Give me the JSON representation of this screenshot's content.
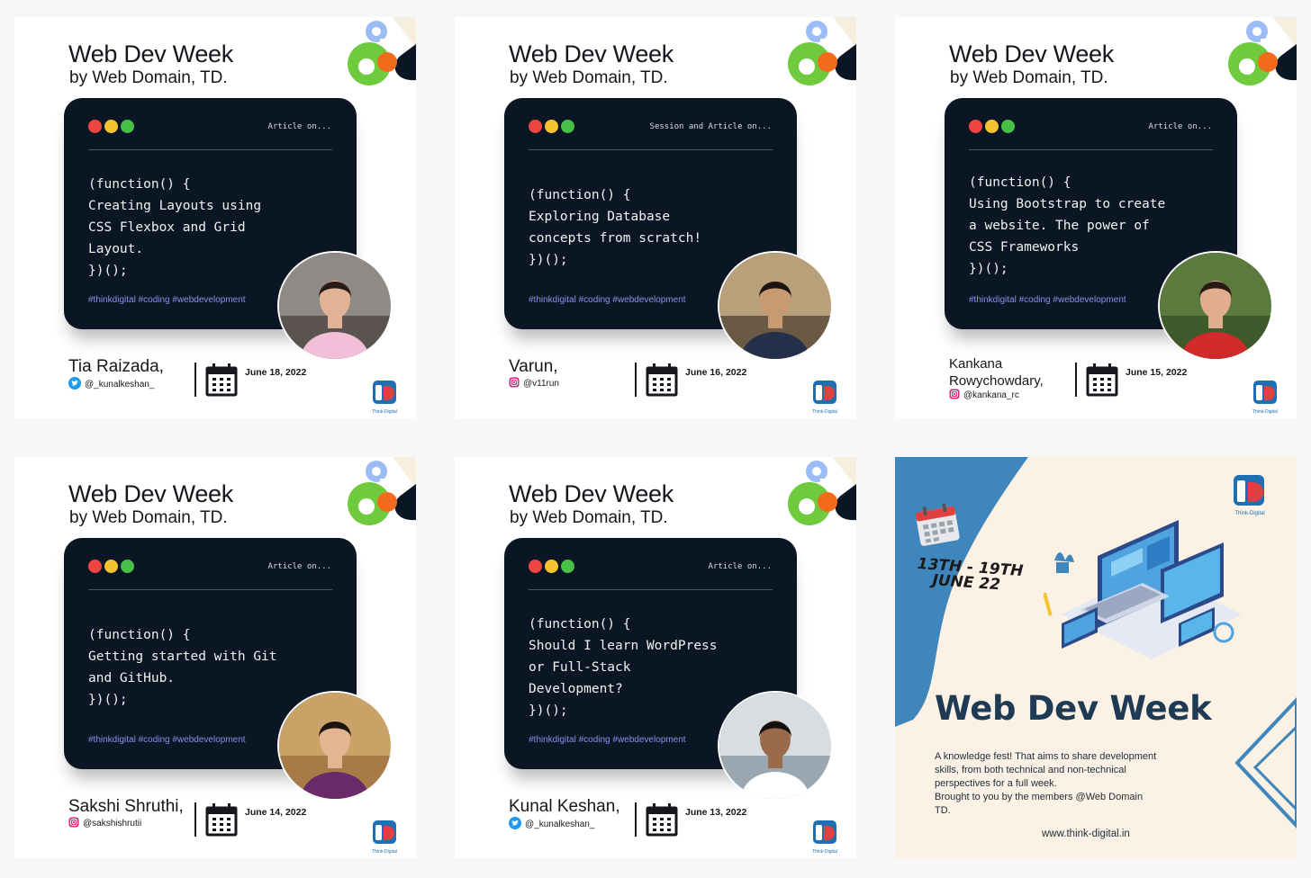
{
  "cards": [
    {
      "title": "Web Dev Week",
      "subtitle": "by Web Domain, TD.",
      "card_label": "Article on...",
      "code_lines": [
        "(function() {",
        "Creating Layouts using",
        "CSS Flexbox and Grid",
        "Layout.",
        "})();"
      ],
      "hashtags": "#thinkdigital #coding #webdevelopment",
      "author_name_lines": [
        "Tia Raizada,"
      ],
      "author_handle": "@_kunalkeshan_",
      "handle_icon": "twitter-icon",
      "date": "June 18, 2022"
    },
    {
      "title": "Web Dev Week",
      "subtitle": "by Web Domain, TD.",
      "card_label": "Session and Article on...",
      "code_lines": [
        "(function() {",
        "Exploring Database",
        "concepts from scratch!",
        "})();"
      ],
      "hashtags": "#thinkdigital #coding #webdevelopment",
      "author_name_lines": [
        "Varun,"
      ],
      "author_handle": "@v11run",
      "handle_icon": "instagram-icon",
      "date": "June 16, 2022"
    },
    {
      "title": "Web Dev Week",
      "subtitle": "by Web Domain, TD.",
      "card_label": "Article on...",
      "code_lines": [
        "(function() {",
        "Using Bootstrap to create",
        "a website. The power of",
        "CSS Frameworks",
        "})();"
      ],
      "hashtags": "#thinkdigital #coding #webdevelopment",
      "author_name_lines": [
        "Kankana",
        "Rowychowdary,"
      ],
      "author_handle": "@kankana_rc",
      "handle_icon": "instagram-icon",
      "date": "June 15, 2022"
    },
    {
      "title": "Web Dev Week",
      "subtitle": "by Web Domain, TD.",
      "card_label": "Article on...",
      "code_lines": [
        "(function() {",
        "Getting started with Git",
        "and GitHub.",
        "})();"
      ],
      "hashtags": "#thinkdigital #coding #webdevelopment",
      "author_name_lines": [
        "Sakshi Shruthi,"
      ],
      "author_handle": "@sakshishrutii",
      "handle_icon": "instagram-icon",
      "date": "June 14, 2022"
    },
    {
      "title": "Web Dev Week",
      "subtitle": "by Web Domain, TD.",
      "card_label": "Article on...",
      "code_lines": [
        "(function() {",
        "Should I learn WordPress",
        "or Full-Stack",
        "Development?",
        "})();"
      ],
      "hashtags": "#thinkdigital #coding #webdevelopment",
      "author_name_lines": [
        "Kunal Keshan,"
      ],
      "author_handle": "@_kunalkeshan_",
      "handle_icon": "twitter-icon",
      "date": "June 13, 2022"
    }
  ],
  "promo": {
    "dates_lines": [
      "13TH - 19TH",
      "JUNE 22"
    ],
    "title": "Web Dev Week",
    "description_lines": [
      "A knowledge fest! That aims to share development",
      "skills, from both technical and non-technical",
      "perspectives for a full week.",
      "Brought to you by the members @Web Domain",
      "TD."
    ],
    "url": "www.think-digital.in",
    "logo_caption": "Think-Digital"
  },
  "colors": {
    "code_bg": "#0b1624",
    "hashtag": "#8d8fe8",
    "dot_red": "#ee4540",
    "dot_yellow": "#f4c430",
    "dot_green": "#48c048",
    "promo_bg": "#fbf1e4",
    "promo_blue": "#3f86bd",
    "promo_title": "#1e3a54"
  }
}
